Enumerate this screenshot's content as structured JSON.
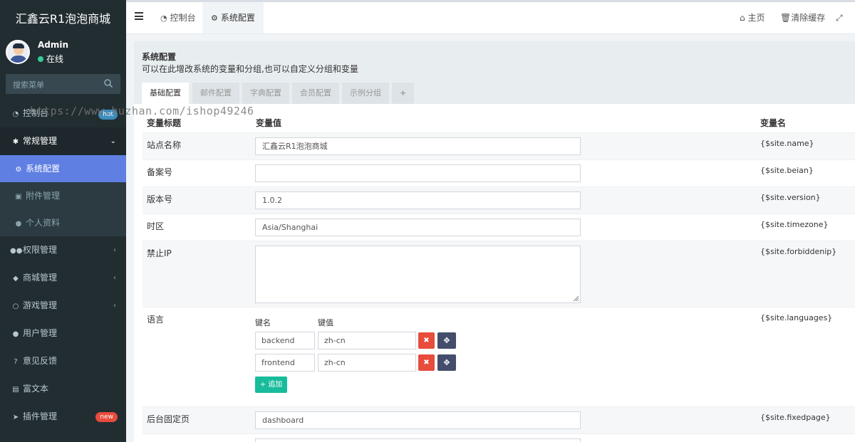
{
  "app": {
    "title": "汇鑫云R1泡泡商城",
    "user": {
      "name": "Admin",
      "status": "在线"
    },
    "search_placeholder": "搜索菜单"
  },
  "sidebar": {
    "items": [
      {
        "label": "控制台",
        "icon": "dashboard-icon",
        "badge": "hot"
      },
      {
        "label": "常规管理",
        "icon": "cogs-icon",
        "open": true,
        "children": [
          {
            "label": "系统配置",
            "icon": "gear-icon",
            "active": true
          },
          {
            "label": "附件管理",
            "icon": "image-file-icon"
          },
          {
            "label": "个人资料",
            "icon": "user-icon"
          }
        ]
      },
      {
        "label": "权限管理",
        "icon": "users-icon"
      },
      {
        "label": "商城管理",
        "icon": "dropbox-icon"
      },
      {
        "label": "游戏管理",
        "icon": "circle-icon"
      },
      {
        "label": "用户管理",
        "icon": "user-icon"
      },
      {
        "label": "意见反馈",
        "icon": "question-circle-icon"
      },
      {
        "label": "富文本",
        "icon": "rich-text-icon"
      },
      {
        "label": "插件管理",
        "icon": "rocket-icon",
        "badge": "new"
      }
    ]
  },
  "header": {
    "tabs": [
      {
        "label": "控制台",
        "icon": "dashboard-icon"
      },
      {
        "label": "系统配置",
        "icon": "gear-icon",
        "active": true
      }
    ],
    "home_label": "主页",
    "clear_cache_label": "清除缓存"
  },
  "panel": {
    "title": "系统配置",
    "description": "可以在此增改系统的变量和分组,也可以自定义分组和变量",
    "tabs": [
      "基础配置",
      "邮件配置",
      "字典配置",
      "会员配置",
      "示例分组",
      "+"
    ]
  },
  "table": {
    "headers": [
      "变量标题",
      "变量值",
      "变量名"
    ],
    "rows": [
      {
        "title": "站点名称",
        "value": "汇鑫云R1泡泡商城",
        "var": "{$site.name}"
      },
      {
        "title": "备案号",
        "value": "",
        "var": "{$site.beian}"
      },
      {
        "title": "版本号",
        "value": "1.0.2",
        "var": "{$site.version}"
      },
      {
        "title": "时区",
        "value": "Asia/Shanghai",
        "var": "{$site.timezone}"
      },
      {
        "title": "禁止IP",
        "value": "",
        "var": "{$site.forbiddenip}"
      },
      {
        "title": "语言",
        "var": "{$site.languages}",
        "key_label": "键名",
        "value_label": "键值",
        "pairs": [
          {
            "key": "backend",
            "value": "zh-cn"
          },
          {
            "key": "frontend",
            "value": "zh-cn"
          }
        ],
        "add_label": "追加"
      },
      {
        "title": "后台固定页",
        "value": "dashboard",
        "var": "{$site.fixedpage}"
      }
    ]
  },
  "watermark": "https://www.huzhan.com/ishop49246",
  "colors": {
    "sidebar_bg": "#222d32",
    "active_item": "#5f7fe3",
    "danger": "#e74c3c",
    "success": "#18bc9c",
    "move_button": "#444d6b"
  }
}
